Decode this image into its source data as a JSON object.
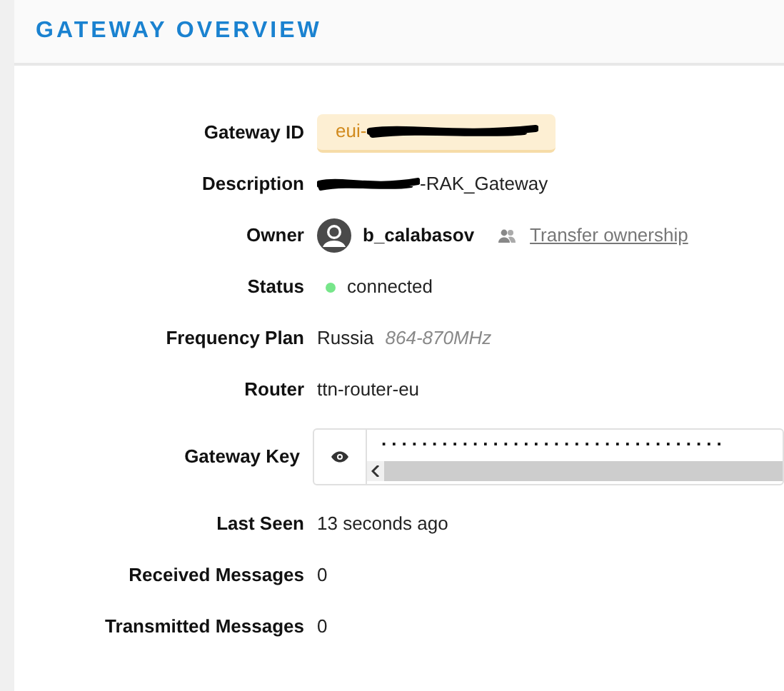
{
  "title": "GATEWAY OVERVIEW",
  "fields": [
    {
      "kind": "badge",
      "label": "Gateway ID",
      "value": "eui-",
      "redacted": true
    },
    {
      "kind": "text",
      "label": "Description",
      "value": "-RAK_Gateway",
      "redacted": true
    },
    {
      "kind": "owner",
      "label": "Owner",
      "value": "b_calabasov",
      "link": "Transfer ownership"
    },
    {
      "kind": "status",
      "label": "Status",
      "value": "connected",
      "color": "#77e68a"
    },
    {
      "kind": "frequency",
      "label": "Frequency Plan",
      "value": "Russia",
      "note": "864-870MHz"
    },
    {
      "kind": "text",
      "label": "Router",
      "value": "ttn-router-eu",
      "redacted": false
    },
    {
      "kind": "key",
      "label": "Gateway Key",
      "value": ".................................."
    },
    {
      "kind": "text",
      "label": "Last Seen",
      "value": "13 seconds ago",
      "redacted": false
    },
    {
      "kind": "text",
      "label": "Received Messages",
      "value": "0",
      "redacted": false
    },
    {
      "kind": "text",
      "label": "Transmitted Messages",
      "value": "0",
      "redacted": false
    }
  ]
}
